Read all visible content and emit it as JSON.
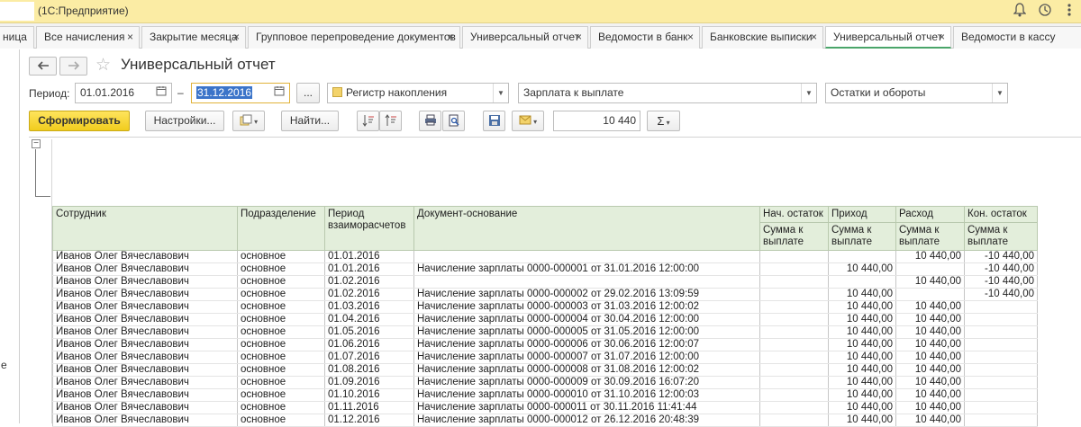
{
  "titlebar": {
    "app_title": "(1С:Предприятие)"
  },
  "tabs": [
    {
      "label": "ница"
    },
    {
      "label": "Все начисления"
    },
    {
      "label": "Закрытие месяца"
    },
    {
      "label": "Групповое перепроведение документов"
    },
    {
      "label": "Универсальный отчет"
    },
    {
      "label": "Ведомости в банк"
    },
    {
      "label": "Банковские выписки"
    },
    {
      "label": "Универсальный отчет"
    },
    {
      "label": "Ведомости в кассу"
    }
  ],
  "close_glyph": "×",
  "left_strip_letter": "е",
  "header": {
    "title": "Универсальный отчет"
  },
  "period": {
    "label": "Период:",
    "from": "01.01.2016",
    "dash": "–",
    "to": "31.12.2016",
    "more_button": "..."
  },
  "selects": {
    "register_type": "Регистр накопления",
    "register": "Зарплата к выплате",
    "report_kind": "Остатки и обороты"
  },
  "toolbar": {
    "generate_label": "Сформировать",
    "settings_label": "Настройки...",
    "find_label": "Найти...",
    "sum_value": "10 440",
    "sum_glyph": "Σ"
  },
  "table": {
    "headers": {
      "employee": "Сотрудник",
      "department": "Подразделение",
      "period": "Период взаиморасчетов",
      "document": "Документ-основание",
      "start": "Нач. остаток",
      "income": "Приход",
      "expense": "Расход",
      "end": "Кон. остаток",
      "sub": "Сумма к выплате"
    },
    "rows": [
      {
        "employee": "Иванов Олег Вячеславович",
        "department": "основное",
        "period": "01.01.2016",
        "document": "",
        "start": "",
        "income": "",
        "expense": "10 440,00",
        "end": "-10 440,00"
      },
      {
        "employee": "Иванов Олег Вячеславович",
        "department": "основное",
        "period": "01.01.2016",
        "document": "Начисление зарплаты 0000-000001 от 31.01.2016 12:00:00",
        "start": "",
        "income": "10 440,00",
        "expense": "",
        "end": "-10 440,00"
      },
      {
        "employee": "Иванов Олег Вячеславович",
        "department": "основное",
        "period": "01.02.2016",
        "document": "",
        "start": "",
        "income": "",
        "expense": "10 440,00",
        "end": "-10 440,00"
      },
      {
        "employee": "Иванов Олег Вячеславович",
        "department": "основное",
        "period": "01.02.2016",
        "document": "Начисление зарплаты 0000-000002 от 29.02.2016 13:09:59",
        "start": "",
        "income": "10 440,00",
        "expense": "",
        "end": "-10 440,00"
      },
      {
        "employee": "Иванов Олег Вячеславович",
        "department": "основное",
        "period": "01.03.2016",
        "document": "Начисление зарплаты 0000-000003 от 31.03.2016 12:00:02",
        "start": "",
        "income": "10 440,00",
        "expense": "10 440,00",
        "end": ""
      },
      {
        "employee": "Иванов Олег Вячеславович",
        "department": "основное",
        "period": "01.04.2016",
        "document": "Начисление зарплаты 0000-000004 от 30.04.2016 12:00:00",
        "start": "",
        "income": "10 440,00",
        "expense": "10 440,00",
        "end": ""
      },
      {
        "employee": "Иванов Олег Вячеславович",
        "department": "основное",
        "period": "01.05.2016",
        "document": "Начисление зарплаты 0000-000005 от 31.05.2016 12:00:00",
        "start": "",
        "income": "10 440,00",
        "expense": "10 440,00",
        "end": ""
      },
      {
        "employee": "Иванов Олег Вячеславович",
        "department": "основное",
        "period": "01.06.2016",
        "document": "Начисление зарплаты 0000-000006 от 30.06.2016 12:00:07",
        "start": "",
        "income": "10 440,00",
        "expense": "10 440,00",
        "end": ""
      },
      {
        "employee": "Иванов Олег Вячеславович",
        "department": "основное",
        "period": "01.07.2016",
        "document": "Начисление зарплаты 0000-000007 от 31.07.2016 12:00:00",
        "start": "",
        "income": "10 440,00",
        "expense": "10 440,00",
        "end": ""
      },
      {
        "employee": "Иванов Олег Вячеславович",
        "department": "основное",
        "period": "01.08.2016",
        "document": "Начисление зарплаты 0000-000008 от 31.08.2016 12:00:02",
        "start": "",
        "income": "10 440,00",
        "expense": "10 440,00",
        "end": ""
      },
      {
        "employee": "Иванов Олег Вячеславович",
        "department": "основное",
        "period": "01.09.2016",
        "document": "Начисление зарплаты 0000-000009 от 30.09.2016 16:07:20",
        "start": "",
        "income": "10 440,00",
        "expense": "10 440,00",
        "end": ""
      },
      {
        "employee": "Иванов Олег Вячеславович",
        "department": "основное",
        "period": "01.10.2016",
        "document": "Начисление зарплаты 0000-000010 от 31.10.2016 12:00:03",
        "start": "",
        "income": "10 440,00",
        "expense": "10 440,00",
        "end": ""
      },
      {
        "employee": "Иванов Олег Вячеславович",
        "department": "основное",
        "period": "01.11.2016",
        "document": "Начисление зарплаты 0000-000011 от 30.11.2016 11:41:44",
        "start": "",
        "income": "10 440,00",
        "expense": "10 440,00",
        "end": ""
      },
      {
        "employee": "Иванов Олег Вячеславович",
        "department": "основное",
        "period": "01.12.2016",
        "document": "Начисление зарплаты 0000-000012 от 26.12.2016 20:48:39",
        "start": "",
        "income": "10 440,00",
        "expense": "10 440,00",
        "end": ""
      }
    ]
  }
}
